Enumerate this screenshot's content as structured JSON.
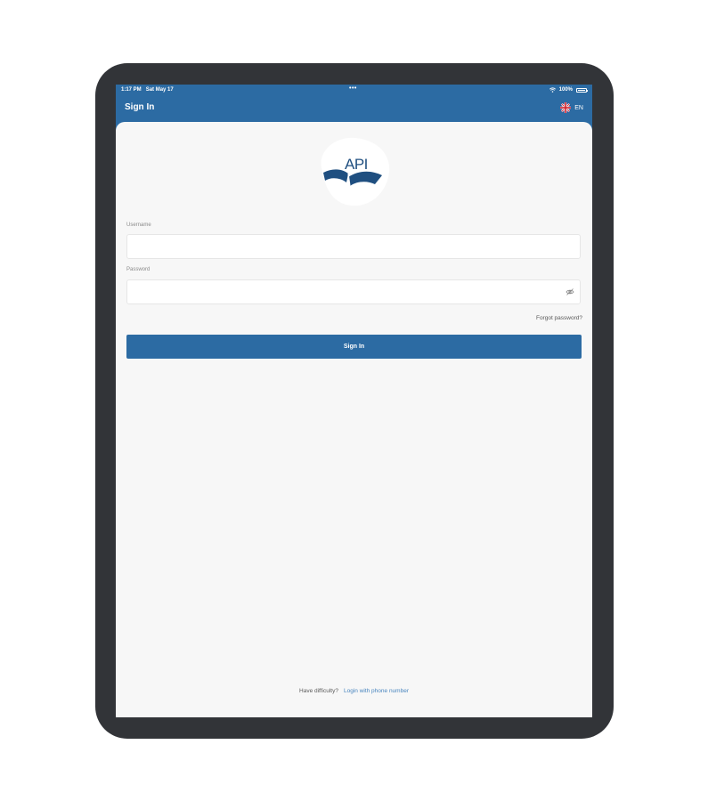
{
  "status_bar": {
    "time": "1:17 PM",
    "date": "Sat May 17",
    "dots": "•••",
    "battery": "100%"
  },
  "nav": {
    "title": "Sign In",
    "language": "EN"
  },
  "logo": {
    "text": "API"
  },
  "form": {
    "username_label": "Username",
    "username_value": "",
    "password_label": "Password",
    "password_value": "",
    "forgot_password": "Forgot password?",
    "submit_label": "Sign In"
  },
  "footer": {
    "prompt": "Have difficulty?",
    "link": "Login with phone number"
  },
  "colors": {
    "brand": "#2c6ba3",
    "device_frame": "#323438",
    "background": "#f7f7f7",
    "link": "#4a86bf"
  }
}
